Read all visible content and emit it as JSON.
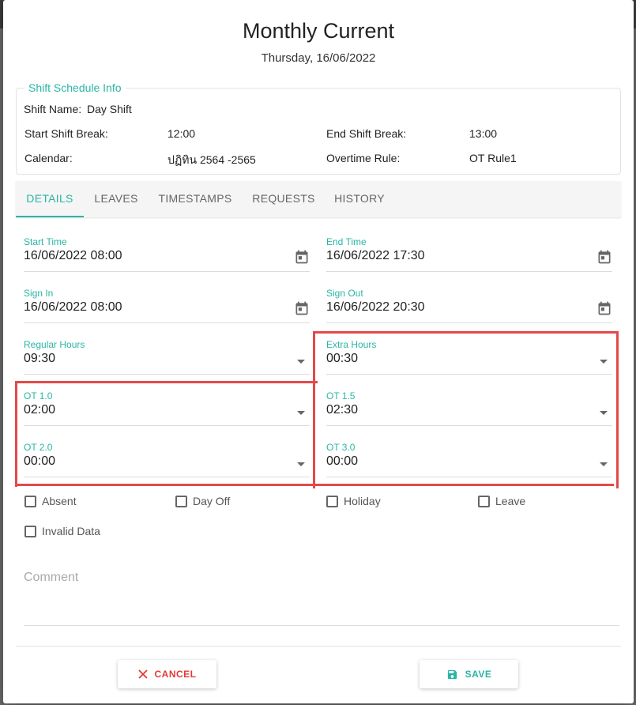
{
  "dialog": {
    "title": "Monthly Current",
    "date": "Thursday, 16/06/2022"
  },
  "shift_info": {
    "legend": "Shift Schedule Info",
    "shift_name_label": "Shift Name:",
    "shift_name_value": "Day Shift",
    "start_break_label": "Start Shift Break:",
    "start_break_value": "12:00",
    "end_break_label": "End Shift Break:",
    "end_break_value": "13:00",
    "calendar_label": "Calendar:",
    "calendar_value": "ปฏิทิน 2564 -2565",
    "ot_rule_label": "Overtime Rule:",
    "ot_rule_value": "OT Rule1"
  },
  "tabs": [
    {
      "label": "DETAILS",
      "active": true
    },
    {
      "label": "LEAVES"
    },
    {
      "label": "TIMESTAMPS"
    },
    {
      "label": "REQUESTS"
    },
    {
      "label": "HISTORY"
    }
  ],
  "fields": {
    "start_time": {
      "label": "Start Time",
      "value": "16/06/2022 08:00"
    },
    "end_time": {
      "label": "End Time",
      "value": "16/06/2022 17:30"
    },
    "sign_in": {
      "label": "Sign In",
      "value": "16/06/2022 08:00"
    },
    "sign_out": {
      "label": "Sign Out",
      "value": "16/06/2022 20:30"
    },
    "regular_hours": {
      "label": "Regular Hours",
      "value": "09:30"
    },
    "extra_hours": {
      "label": "Extra Hours",
      "value": "00:30"
    },
    "ot_1_0": {
      "label": "OT 1.0",
      "value": "02:00"
    },
    "ot_1_5": {
      "label": "OT 1.5",
      "value": "02:30"
    },
    "ot_2_0": {
      "label": "OT 2.0",
      "value": "00:00"
    },
    "ot_3_0": {
      "label": "OT 3.0",
      "value": "00:00"
    }
  },
  "checkboxes": {
    "absent": "Absent",
    "day_off": "Day Off",
    "holiday": "Holiday",
    "leave": "Leave",
    "invalid_data": "Invalid Data"
  },
  "comment": {
    "placeholder": "Comment"
  },
  "buttons": {
    "cancel": "CANCEL",
    "save": "SAVE"
  },
  "colors": {
    "accent": "#2bb5a5",
    "danger": "#e53935",
    "highlight": "#e54848"
  }
}
